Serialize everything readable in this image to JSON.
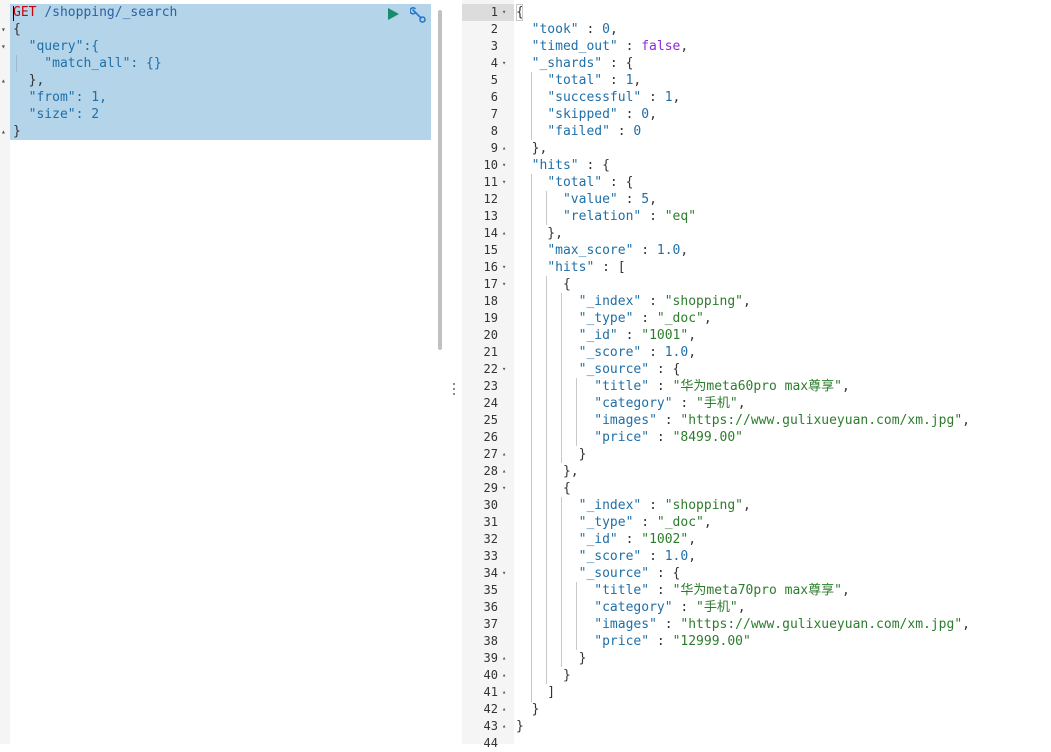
{
  "request": {
    "method": "GET",
    "path": "/shopping/_search",
    "lines": [
      "{",
      "  \"query\":{",
      "    \"match_all\": {}",
      "  },",
      "  \"from\": 1,",
      "  \"size\": 2",
      "}"
    ],
    "run_icon": "play-icon",
    "settings_icon": "wrench-icon"
  },
  "response": {
    "line_numbers": [
      "1",
      "2",
      "3",
      "4",
      "5",
      "6",
      "7",
      "8",
      "9",
      "10",
      "11",
      "12",
      "13",
      "14",
      "15",
      "16",
      "17",
      "18",
      "19",
      "20",
      "21",
      "22",
      "23",
      "24",
      "25",
      "26",
      "27",
      "28",
      "29",
      "30",
      "31",
      "32",
      "33",
      "34",
      "35",
      "36",
      "37",
      "38",
      "39",
      "40",
      "41",
      "42",
      "43",
      "44"
    ],
    "lines": [
      "{",
      "  \"took\" : 0,",
      "  \"timed_out\" : false,",
      "  \"_shards\" : {",
      "    \"total\" : 1,",
      "    \"successful\" : 1,",
      "    \"skipped\" : 0,",
      "    \"failed\" : 0",
      "  },",
      "  \"hits\" : {",
      "    \"total\" : {",
      "      \"value\" : 5,",
      "      \"relation\" : \"eq\"",
      "    },",
      "    \"max_score\" : 1.0,",
      "    \"hits\" : [",
      "      {",
      "        \"_index\" : \"shopping\",",
      "        \"_type\" : \"_doc\",",
      "        \"_id\" : \"1001\",",
      "        \"_score\" : 1.0,",
      "        \"_source\" : {",
      "          \"title\" : \"华为meta60pro max尊享\",",
      "          \"category\" : \"手机\",",
      "          \"images\" : \"https://www.gulixueyuan.com/xm.jpg\",",
      "          \"price\" : \"8499.00\"",
      "        }",
      "      },",
      "      {",
      "        \"_index\" : \"shopping\",",
      "        \"_type\" : \"_doc\",",
      "        \"_id\" : \"1002\",",
      "        \"_score\" : 1.0,",
      "        \"_source\" : {",
      "          \"title\" : \"华为meta70pro max尊享\",",
      "          \"category\" : \"手机\",",
      "          \"images\" : \"https://www.gulixueyuan.com/xm.jpg\",",
      "          \"price\" : \"12999.00\"",
      "        }",
      "      }",
      "    ]",
      "  }",
      "}",
      ""
    ]
  },
  "colors": {
    "selection": "#b3d4e9",
    "gutter": "#f5f5f5",
    "method": "#c5060b",
    "key": "#1f6fa8",
    "string": "#2d7c2d",
    "run": "#1a8c6e"
  }
}
